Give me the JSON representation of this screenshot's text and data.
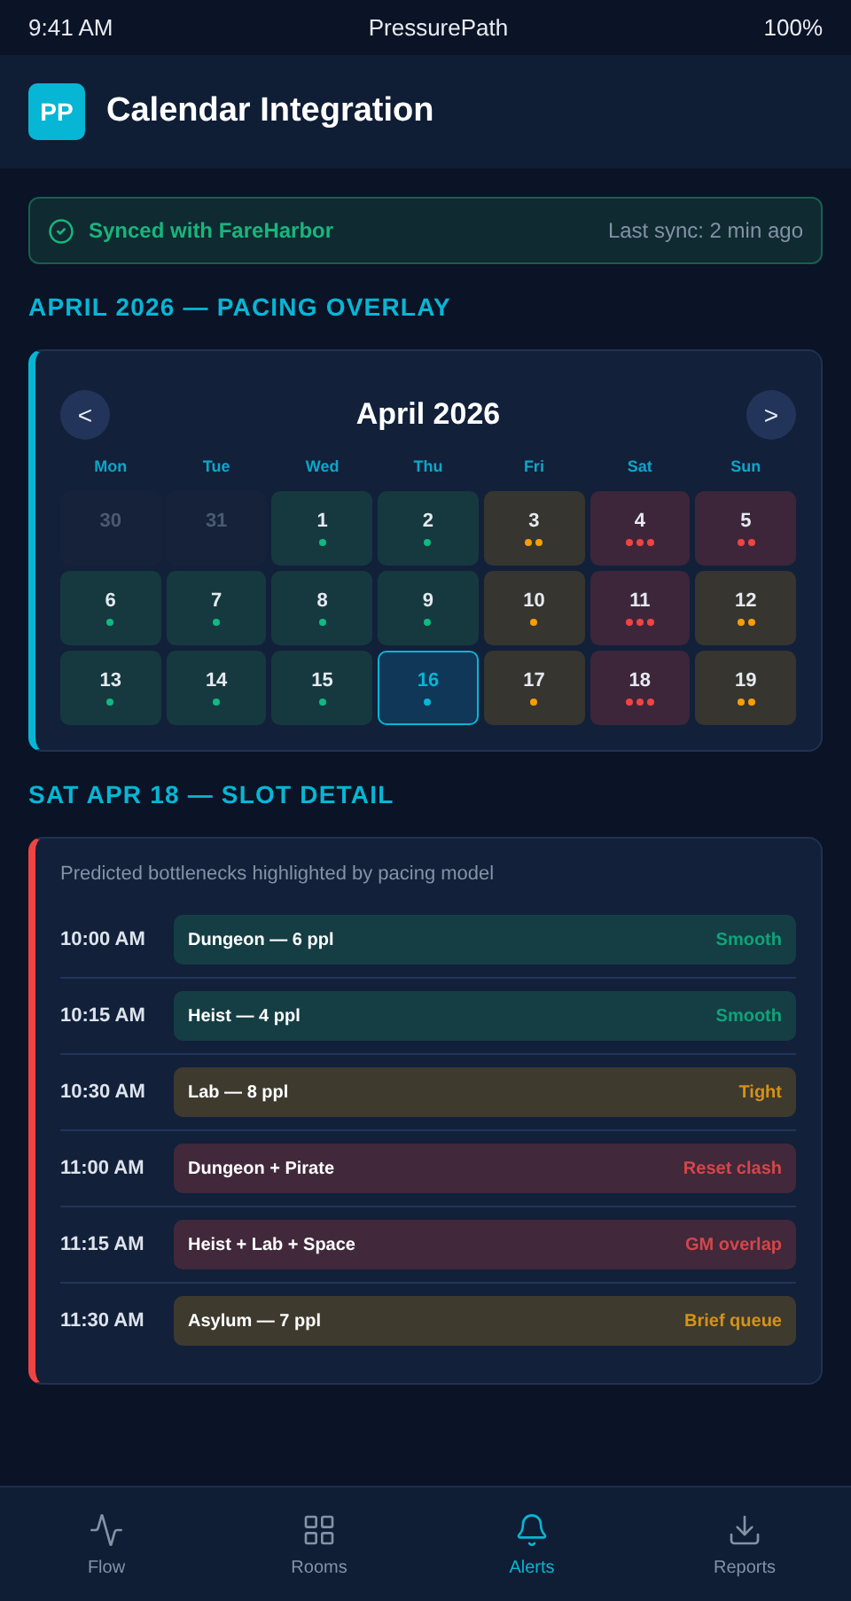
{
  "status_bar": {
    "time": "9:41 AM",
    "app": "PressurePath",
    "battery": "100%"
  },
  "header": {
    "logo": "PP",
    "title": "Calendar Integration"
  },
  "sync": {
    "label": "Synced with FareHarbor",
    "last_sync": "Last sync: 2 min ago"
  },
  "overlay_title": "APRIL 2026 — PACING OVERLAY",
  "calendar": {
    "prev": "<",
    "month": "April 2026",
    "next": ">",
    "weekdays": [
      "Mon",
      "Tue",
      "Wed",
      "Thu",
      "Fri",
      "Sat",
      "Sun"
    ],
    "days": [
      {
        "day": "30",
        "kind": "outside",
        "selected": false
      },
      {
        "day": "31",
        "kind": "outside",
        "selected": false
      },
      {
        "day": "1",
        "kind": "smooth",
        "dots": [
          {
            "color": "#10b981"
          }
        ],
        "selected": false
      },
      {
        "day": "2",
        "kind": "smooth",
        "dots": [
          {
            "color": "#10b981"
          }
        ],
        "selected": false
      },
      {
        "day": "3",
        "kind": "tight",
        "dots": [
          {
            "color": "#f59e0b"
          },
          {
            "color": "#f59e0b"
          }
        ],
        "selected": false
      },
      {
        "day": "4",
        "kind": "clash",
        "dots": [
          {
            "color": "#ef4444"
          },
          {
            "color": "#ef4444"
          },
          {
            "color": "#ef4444"
          }
        ],
        "selected": false
      },
      {
        "day": "5",
        "kind": "clash",
        "dots": [
          {
            "color": "#ef4444"
          },
          {
            "color": "#ef4444"
          }
        ],
        "selected": false
      },
      {
        "day": "6",
        "kind": "smooth",
        "dots": [
          {
            "color": "#10b981"
          }
        ],
        "selected": false
      },
      {
        "day": "7",
        "kind": "smooth",
        "dots": [
          {
            "color": "#10b981"
          }
        ],
        "selected": false
      },
      {
        "day": "8",
        "kind": "smooth",
        "dots": [
          {
            "color": "#10b981"
          }
        ],
        "selected": false
      },
      {
        "day": "9",
        "kind": "smooth",
        "dots": [
          {
            "color": "#10b981"
          }
        ],
        "selected": false
      },
      {
        "day": "10",
        "kind": "tight",
        "dots": [
          {
            "color": "#f59e0b"
          }
        ],
        "selected": false
      },
      {
        "day": "11",
        "kind": "clash",
        "dots": [
          {
            "color": "#ef4444"
          },
          {
            "color": "#ef4444"
          },
          {
            "color": "#ef4444"
          }
        ],
        "selected": false
      },
      {
        "day": "12",
        "kind": "tight",
        "dots": [
          {
            "color": "#f59e0b"
          },
          {
            "color": "#f59e0b"
          }
        ],
        "selected": false
      },
      {
        "day": "13",
        "kind": "smooth",
        "dots": [
          {
            "color": "#10b981"
          }
        ],
        "selected": false
      },
      {
        "day": "14",
        "kind": "smooth",
        "dots": [
          {
            "color": "#10b981"
          }
        ],
        "selected": false
      },
      {
        "day": "15",
        "kind": "smooth",
        "dots": [
          {
            "color": "#10b981"
          }
        ],
        "selected": false
      },
      {
        "day": "16",
        "kind": "smooth",
        "dots": [
          {
            "color": "#06b6d4"
          }
        ],
        "selected": true
      },
      {
        "day": "17",
        "kind": "tight",
        "dots": [
          {
            "color": "#f59e0b"
          }
        ],
        "selected": false
      },
      {
        "day": "18",
        "kind": "clash",
        "dots": [
          {
            "color": "#ef4444"
          },
          {
            "color": "#ef4444"
          },
          {
            "color": "#ef4444"
          }
        ],
        "selected": false
      },
      {
        "day": "19",
        "kind": "tight",
        "dots": [
          {
            "color": "#f59e0b"
          },
          {
            "color": "#f59e0b"
          }
        ],
        "selected": false
      }
    ]
  },
  "detail_title": "SAT APR 18 — SLOT DETAIL",
  "detail": {
    "caption": "Predicted bottlenecks highlighted by pacing model",
    "slots": [
      {
        "time": "10:00 AM",
        "booking": "Dungeon — 6 ppl",
        "note": "Smooth",
        "kind": "smooth"
      },
      {
        "time": "10:15 AM",
        "booking": "Heist — 4 ppl",
        "note": "Smooth",
        "kind": "smooth"
      },
      {
        "time": "10:30 AM",
        "booking": "Lab — 8 ppl",
        "note": "Tight",
        "kind": "tight"
      },
      {
        "time": "11:00 AM",
        "booking": "Dungeon + Pirate",
        "note": "Reset clash",
        "kind": "clash"
      },
      {
        "time": "11:15 AM",
        "booking": "Heist + Lab + Space",
        "note": "GM overlap",
        "kind": "clash"
      },
      {
        "time": "11:30 AM",
        "booking": "Asylum — 7 ppl",
        "note": "Brief queue",
        "kind": "tight"
      }
    ]
  },
  "nav": [
    {
      "label": "Flow",
      "selected": false
    },
    {
      "label": "Rooms",
      "selected": false
    },
    {
      "label": "Alerts",
      "selected": true
    },
    {
      "label": "Reports",
      "selected": false
    }
  ]
}
